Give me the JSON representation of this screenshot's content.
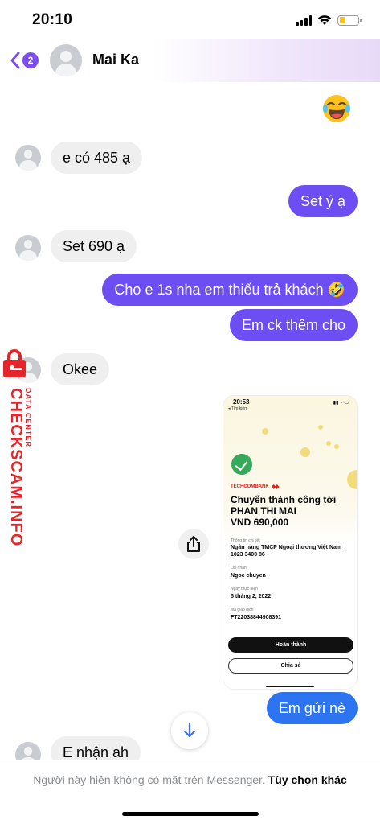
{
  "status_bar": {
    "time": "20:10"
  },
  "header": {
    "unread_count": "2",
    "contact_name": "Mai Ka"
  },
  "messages": [
    {
      "from": "them",
      "text": "e có 485 ạ"
    },
    {
      "from": "me",
      "text": "Set ý ạ"
    },
    {
      "from": "them",
      "text": "Set 690 ạ"
    },
    {
      "from": "me",
      "text": "Cho e 1s nha em thiếu trả khách 🤣"
    },
    {
      "from": "me",
      "text": "Em ck thêm cho"
    },
    {
      "from": "them",
      "text": "Okee"
    },
    {
      "from": "me",
      "text": "Em gửi nè"
    },
    {
      "from": "them",
      "text": "E nhận ah"
    }
  ],
  "receipt": {
    "time": "20:53",
    "back_label": "◂ Tìm kiếm",
    "bank_name": "TECHCOMBANK",
    "title": "Chuyển thành công tới PHAN THI MAI",
    "amount": "VND 690,000",
    "detail_label": "Thông tin chi tiết",
    "detail_value": "Ngân hàng TMCP Ngoại thương Việt Nam 1023 3400 86",
    "message_label": "Lời nhắn",
    "message_value": "Ngoc chuyen",
    "date_label": "Ngày thực hiện",
    "date_value": "5 tháng 2, 2022",
    "txn_label": "Mã giao dịch",
    "txn_value": "FT22038844908391",
    "done_button": "Hoàn thành",
    "share_button": "Chia sẻ"
  },
  "watermark": {
    "main": "CHECKSCAM.INFO",
    "sub": "DATA CENTER"
  },
  "footer": {
    "notice": "Người này hiện không có mặt trên Messenger.",
    "options_link": "Tùy chọn khác"
  },
  "colors": {
    "outgoing_bubble": "#6c4ef2",
    "latest_outgoing_bubble": "#2d75f0",
    "incoming_bubble": "#efefef",
    "watermark": "#e4262b"
  },
  "icons": [
    "signal-icon",
    "wifi-icon",
    "battery-icon",
    "back-chevron-icon",
    "share-icon",
    "arrow-down-icon",
    "lock-icon",
    "laughing-emoji-icon"
  ]
}
